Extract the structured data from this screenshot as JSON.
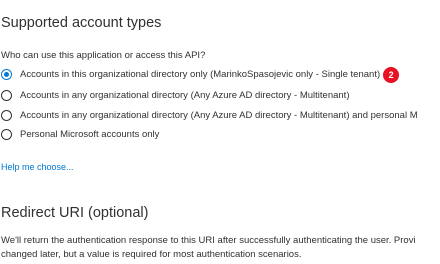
{
  "supported_accounts": {
    "title": "Supported account types",
    "question": "Who can use this application or access this API?",
    "options": [
      {
        "label": "Accounts in this organizational directory only (MarinkoSpasojevic only - Single tenant)",
        "selected": true
      },
      {
        "label": "Accounts in any organizational directory (Any Azure AD directory - Multitenant)",
        "selected": false
      },
      {
        "label": "Accounts in any organizational directory (Any Azure AD directory - Multitenant) and personal M",
        "selected": false
      },
      {
        "label": "Personal Microsoft accounts only",
        "selected": false
      }
    ],
    "step_badge": "2",
    "help_link": "Help me choose..."
  },
  "redirect_uri": {
    "title": "Redirect URI (optional)",
    "description_line1": "We'll return the authentication response to this URI after successfully authenticating the user. Provi",
    "description_line2": "changed later, but a value is required for most authentication scenarios."
  },
  "colors": {
    "accent": "#0078d4",
    "badge": "#e81123",
    "text": "#323130"
  }
}
